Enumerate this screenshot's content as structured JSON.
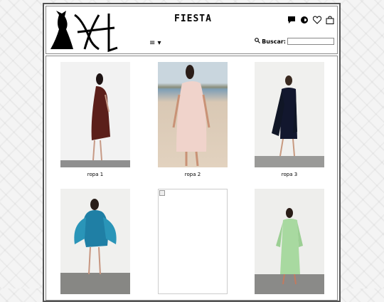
{
  "header": {
    "title": "FIESTA",
    "menu_toggle": "≡ ▾",
    "search_label": "Buscar:",
    "search_placeholder": ""
  },
  "icons": [
    "chat-icon",
    "chat-alt-icon",
    "heart-icon",
    "shopping-bag-icon",
    "search-icon"
  ],
  "products": [
    {
      "label": "ropa 1"
    },
    {
      "label": "ropa 2"
    },
    {
      "label": "ropa 3"
    },
    {
      "label": ""
    },
    {
      "label": ""
    },
    {
      "label": ""
    }
  ]
}
